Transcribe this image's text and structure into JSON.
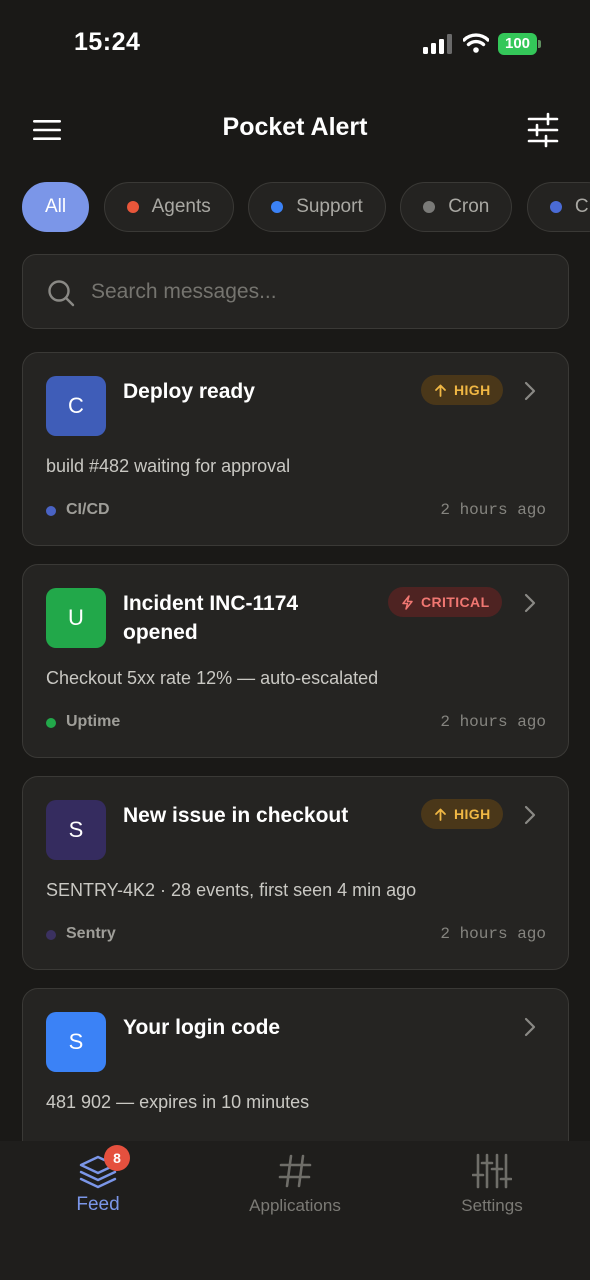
{
  "status_bar": {
    "time": "15:24",
    "battery_level": "100"
  },
  "header": {
    "title": "Pocket Alert"
  },
  "filters": [
    {
      "label": "All",
      "active": true
    },
    {
      "label": "Agents",
      "dot_color": "#e8563a"
    },
    {
      "label": "Support",
      "dot_color": "#3b82f6"
    },
    {
      "label": "Cron",
      "dot_color": "#7a7a78"
    },
    {
      "label": "C",
      "dot_color": "#4a6bd6"
    }
  ],
  "search": {
    "placeholder": "Search messages..."
  },
  "messages": [
    {
      "avatar_letter": "C",
      "avatar_color": "#3f5db8",
      "title": "Deploy ready",
      "priority": "HIGH",
      "priority_icon": "arrow-up-icon",
      "body": "build #482 waiting for approval",
      "app": "CI/CD",
      "app_color": "#4a63c4",
      "time": "2 hours ago"
    },
    {
      "avatar_letter": "U",
      "avatar_color": "#22a84a",
      "title": "Incident INC-1174 opened",
      "priority": "CRITICAL",
      "priority_icon": "lightning-icon",
      "body": "Checkout 5xx rate 12% — auto-escalated",
      "app": "Uptime",
      "app_color": "#22a84a",
      "time": "2 hours ago"
    },
    {
      "avatar_letter": "S",
      "avatar_color": "#352c5f",
      "title": "New issue in checkout",
      "priority": "HIGH",
      "priority_icon": "arrow-up-icon",
      "body": "SENTRY-4K2 · 28 events, first seen 4 min ago",
      "app": "Sentry",
      "app_color": "#3b3160",
      "time": "2 hours ago"
    },
    {
      "avatar_letter": "S",
      "avatar_color": "#3b82f6",
      "title": "Your login code",
      "body": "481 902 — expires in 10 minutes"
    }
  ],
  "tabs": [
    {
      "label": "Feed",
      "icon": "layers-icon",
      "badge": "8",
      "active": true
    },
    {
      "label": "Applications",
      "icon": "hash-icon"
    },
    {
      "label": "Settings",
      "icon": "sliders-icon"
    }
  ],
  "colors": {
    "accent": "#7b96e8",
    "background": "#1a1917",
    "card": "#252422",
    "high": "#f0b744",
    "critical": "#f07772",
    "badge": "#e5503e"
  }
}
